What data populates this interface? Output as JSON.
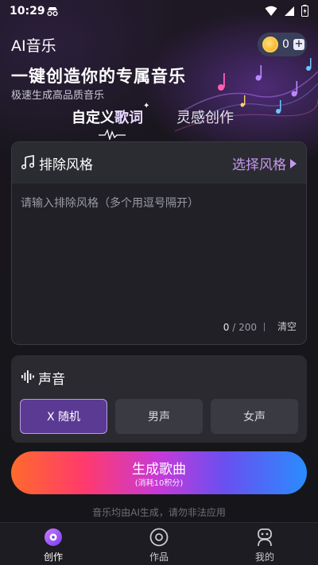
{
  "status_bar": {
    "time": "10:29"
  },
  "header": {
    "app_title": "AI音乐",
    "coin_count": "0",
    "headline": "一键创造你的专属音乐",
    "subline": "极速生成高品质音乐"
  },
  "tabs": {
    "custom_prefix": "自定义",
    "custom_highlight": "歌词",
    "inspire": "灵感创作"
  },
  "lyrics_card": {
    "title": "排除风格",
    "choose_style": "选择风格",
    "placeholder": "请输入排除风格（多个用逗号隔开）",
    "char_count": "0",
    "char_limit": " / 200",
    "clear": "清空"
  },
  "voice_card": {
    "title": "声音",
    "options": [
      "X 随机",
      "男声",
      "女声"
    ],
    "selected_index": 0
  },
  "generate": {
    "label": "生成歌曲",
    "cost": "(消耗10积分)"
  },
  "footnote": "音乐均由AI生成，请勿非法应用",
  "bottom_nav": {
    "items": [
      {
        "label": "创作",
        "icon": "disc-icon",
        "active": true
      },
      {
        "label": "作品",
        "icon": "record-icon",
        "active": false
      },
      {
        "label": "我的",
        "icon": "robot-icon",
        "active": false
      }
    ]
  },
  "colors": {
    "accent": "#c698f0",
    "active_voice": "#5b3a94",
    "gradient": [
      "#ff6a2c",
      "#ff3a6e",
      "#c63ad8",
      "#6a4ff0",
      "#2a8cff"
    ]
  }
}
